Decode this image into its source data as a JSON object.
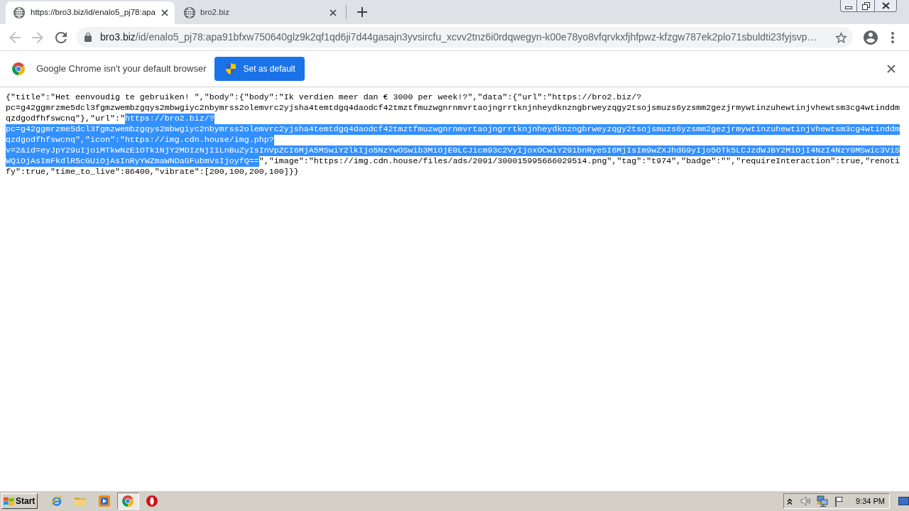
{
  "tabs": [
    {
      "title": "https://bro3.biz/id/enalo5_pj78:apa",
      "selected": true
    },
    {
      "title": "bro2.biz",
      "selected": false
    }
  ],
  "toolbar": {
    "back": {
      "disabled": true
    },
    "forward": {
      "disabled": true
    },
    "address": {
      "host": "bro3.biz",
      "path": "/id/enalo5_pj78:apa91bfxw750640glz9k2qf1qd6ji7d44gasajn3yvsircfu_xcvv2tnz6i0rdqwegyn-k00e78yo8vfqrvkxfjhfpwz-kfzgw787ek2plo71sbuldti23fyjsvp…"
    }
  },
  "infobar": {
    "message": "Google Chrome isn't your default browser",
    "button": "Set as default"
  },
  "document": {
    "lines": [
      {
        "segments": [
          {
            "text": "{\"title\":\"Het eenvoudig te gebruiken! \",\"body\":{\"body\":\"Ik verdien meer dan € 3000 per week!?\",\"data\":{\"url\":\"https://bro2.biz/?",
            "selected": false
          }
        ]
      },
      {
        "segments": [
          {
            "text": "pc=g42ggmrzme5dcl3fgmzwembzgqys2mbwgiyc2nbymrss2olemvrc2yjsha4temtdgq4daodcf42tmztfmuzwgnrnmvrtaojngrrtknjnheydknzngbrweyzqgy2tsojsmuzs6yzsmm2gezjrmywtinzuhewtinjvhewtsm3cg4wtinddm",
            "selected": false
          }
        ]
      },
      {
        "segments": [
          {
            "text": "qzdgodfhfswcnq\"},\"url\":\"",
            "selected": false
          },
          {
            "text": "https://bro2.biz/?",
            "selected": true
          }
        ]
      },
      {
        "segments": [
          {
            "text": "pc=g42ggmrzme5dcl3fgmzwembzgqys2mbwgiyc2nbymrss2olemvrc2yjsha4temtdgq4daodcf42tmztfmuzwgnrnmvrtaojngrrtknjnheydknzngbrweyzqgy2tsojsmuzs6yzsmm2gezjrmywtinzuhewtinjvhewtsm3cg4wtinddm",
            "selected": true
          }
        ]
      },
      {
        "segments": [
          {
            "text": "qzdgodfhfswcnq\",\"icon\":\"https://img.cdn.house/img.php?",
            "selected": true
          }
        ]
      },
      {
        "segments": [
          {
            "text": "v=2&id=eyJpY29uIjoiMTkwNzE1OTk1NjY2MDIzNjI1LnBuZyIsInVpZCI6MjA5MSwiY2lkIjo5NzYwOSwib3MiOjE0LCJicm93c2VyIjoxOCwiY291bnRyeSI6MjIsIm9wZXJhdG9yIjo5OTk5LCJzdWJBY2MiOjI4NzI4NzY0MSwic3ViS",
            "selected": true
          }
        ]
      },
      {
        "segments": [
          {
            "text": "WQiOjAsImFkdlR5cGUiOjAsInRyYWZmaWNDaGFubmVsIjoyfQ==",
            "selected": true
          },
          {
            "text": "\",\"image\":\"https://img.cdn.house/files/ads/2091/300015995666029514.png\",\"tag\":\"t974\",\"badge\":\"\",\"requireInteraction\":true,\"renoti",
            "selected": false
          }
        ]
      },
      {
        "segments": [
          {
            "text": "fy\":true,\"time_to_live\":86400,\"vibrate\":[200,100,200,100]}}",
            "selected": false
          }
        ]
      }
    ]
  },
  "taskbar": {
    "start": "Start",
    "apps": [
      {
        "kind": "e-logo",
        "selected": false
      },
      {
        "kind": "folder",
        "selected": false
      },
      {
        "kind": "player",
        "selected": false
      },
      {
        "kind": "round-logo",
        "selected": true
      },
      {
        "kind": "ring-logo",
        "selected": false
      }
    ],
    "clock": "9:34 PM"
  }
}
